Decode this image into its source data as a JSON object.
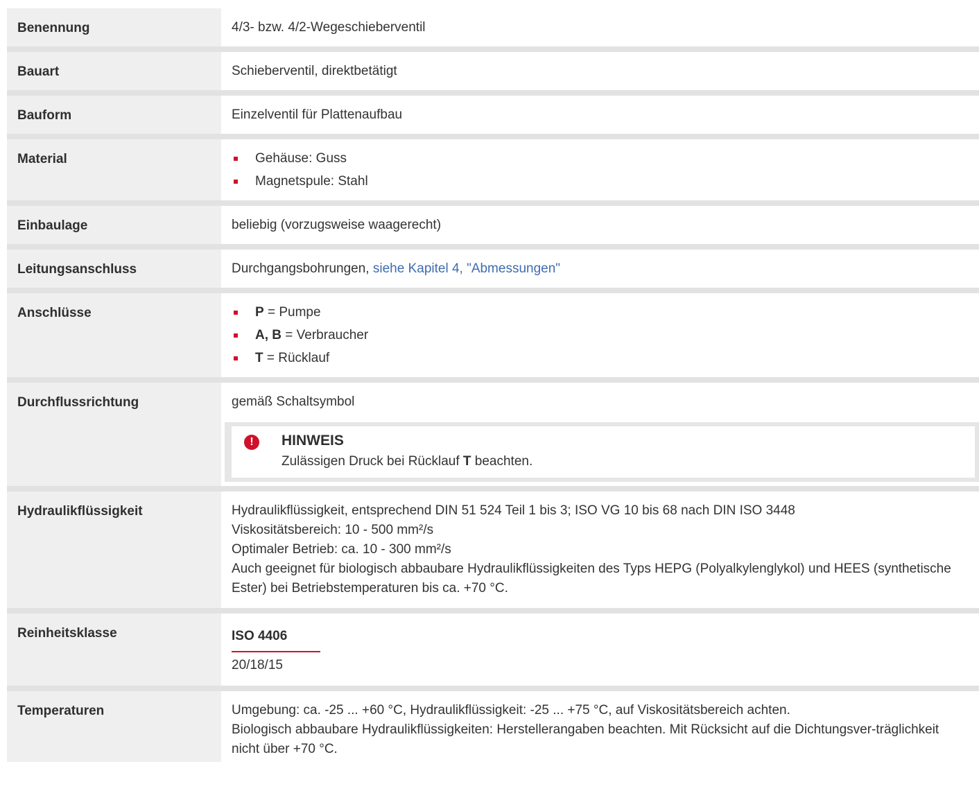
{
  "rows": {
    "benennung": {
      "label": "Benennung",
      "value": "4/3- bzw. 4/2-Wegeschieberventil"
    },
    "bauart": {
      "label": "Bauart",
      "value": "Schieberventil, direktbetätigt"
    },
    "bauform": {
      "label": "Bauform",
      "value": "Einzelventil für Plattenaufbau"
    },
    "material": {
      "label": "Material",
      "items": [
        "Gehäuse: Guss",
        "Magnetspule: Stahl"
      ]
    },
    "einbaulage": {
      "label": "Einbaulage",
      "value": "beliebig (vorzugsweise waagerecht)"
    },
    "leitungsanschluss": {
      "label": "Leitungsanschluss",
      "value": "Durchgangsbohrungen, ",
      "link": "siehe Kapitel 4, \"Abmessungen\""
    },
    "anschluesse": {
      "label": "Anschlüsse",
      "items": [
        {
          "key": "P",
          "text": " = Pumpe"
        },
        {
          "key": "A, B",
          "text": " = Verbraucher"
        },
        {
          "key": "T",
          "text": " = Rücklauf"
        }
      ]
    },
    "durchflussrichtung": {
      "label": "Durchflussrichtung",
      "value": "gemäß Schaltsymbol",
      "notice": {
        "icon": "exclamation-icon",
        "title": "HINWEIS",
        "text_before": "Zulässigen Druck bei Rücklauf ",
        "text_bold": "T",
        "text_after": " beachten."
      }
    },
    "hydraulikfluessigkeit": {
      "label": "Hydraulikflüssigkeit",
      "lines": [
        "Hydraulikflüssigkeit, entsprechend DIN 51 524 Teil 1 bis 3; ISO VG 10 bis 68 nach DIN ISO 3448",
        "Viskositätsbereich: 10 - 500 mm²/s",
        "Optimaler Betrieb: ca. 10 - 300 mm²/s",
        "Auch geeignet für biologisch abbaubare Hydraulikflüssigkeiten des Typs HEPG (Polyalkylenglykol) und HEES (synthetische Ester) bei Betriebstemperaturen bis ca. +70 °C."
      ]
    },
    "reinheitsklasse": {
      "label": "Reinheitsklasse",
      "head": "ISO 4406",
      "value": "20/18/15"
    },
    "temperaturen": {
      "label": "Temperaturen",
      "lines": [
        "Umgebung: ca. -25 ... +60 °C, Hydraulikflüssigkeit: -25 ... +75 °C, auf Viskositätsbereich achten.",
        "Biologisch abbaubare Hydraulikflüssigkeiten: Herstellerangaben beachten. Mit Rücksicht auf die Dichtungsver-träglichkeit nicht über +70 °C."
      ]
    }
  },
  "colors": {
    "accent": "#d0112b",
    "link": "#3f6cb0",
    "label_bg": "#efefef",
    "separator": "#e2e2e2"
  }
}
